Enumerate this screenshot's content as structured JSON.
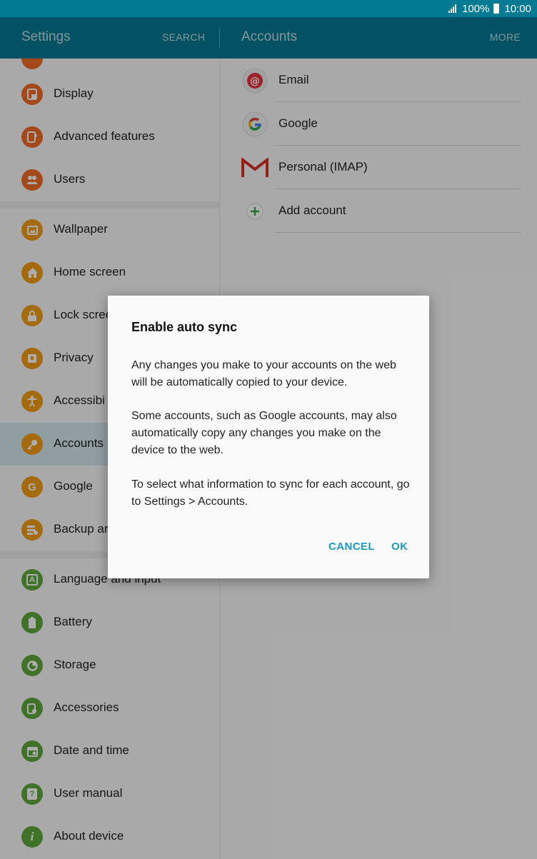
{
  "status": {
    "battery": "100%",
    "time": "10:00"
  },
  "appbar": {
    "title_left": "Settings",
    "search": "SEARCH",
    "title_right": "Accounts",
    "more": "MORE"
  },
  "settings_items": [
    {
      "label": "Display",
      "icon": "display-icon"
    },
    {
      "label": "Advanced features",
      "icon": "advanced-features-icon"
    },
    {
      "label": "Users",
      "icon": "users-icon"
    },
    {
      "label": "Wallpaper",
      "icon": "wallpaper-icon"
    },
    {
      "label": "Home screen",
      "icon": "home-icon"
    },
    {
      "label": "Lock scree",
      "icon": "lock-icon"
    },
    {
      "label": "Privacy",
      "icon": "privacy-icon"
    },
    {
      "label": "Accessibi",
      "icon": "accessibility-icon"
    },
    {
      "label": "Accounts",
      "icon": "key-icon"
    },
    {
      "label": "Google",
      "icon": "google-g-icon",
      "glyph": "G"
    },
    {
      "label": "Backup ar",
      "icon": "backup-icon"
    },
    {
      "label": "Language and input",
      "icon": "language-icon",
      "glyph": "A"
    },
    {
      "label": "Battery",
      "icon": "battery-icon"
    },
    {
      "label": "Storage",
      "icon": "storage-icon"
    },
    {
      "label": "Accessories",
      "icon": "accessories-icon"
    },
    {
      "label": "Date and time",
      "icon": "calendar-icon"
    },
    {
      "label": "User manual",
      "icon": "manual-icon",
      "glyph": "?"
    },
    {
      "label": "About device",
      "icon": "info-icon",
      "glyph": "i"
    }
  ],
  "accounts": [
    {
      "label": "Email",
      "icon": "email-icon"
    },
    {
      "label": "Google",
      "icon": "google-icon"
    },
    {
      "label": "Personal (IMAP)",
      "icon": "gmail-icon"
    },
    {
      "label": "Add account",
      "icon": "add-icon"
    }
  ],
  "dialog": {
    "title": "Enable auto sync",
    "paragraphs": [
      "Any changes you make to your accounts on the web will be automatically copied to your device.",
      "Some accounts, such as Google accounts, may also automatically copy any changes you make on the device to the web.",
      "To select what information to sync for each account, go to Settings > Accounts."
    ],
    "cancel": "CANCEL",
    "ok": "OK"
  },
  "colors": {
    "appbar": "#037a93",
    "accent": "#1a9bbf",
    "selected": "#d4e8ee"
  }
}
